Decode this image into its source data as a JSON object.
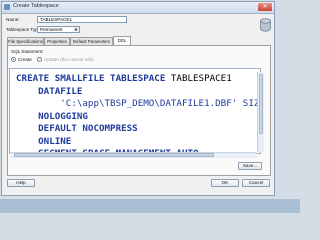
{
  "window": {
    "title": "Create Tablespace"
  },
  "form": {
    "name_label": "Name:",
    "name_value": "TABLESPACE1",
    "type_label": "Tablespace Type:",
    "type_value": "Permanent"
  },
  "tabs": [
    {
      "label": "File Specifications"
    },
    {
      "label": "Properties"
    },
    {
      "label": "Default Parameters"
    },
    {
      "label": "DDL"
    }
  ],
  "ddl": {
    "statement_label": "SQL Statement:",
    "mode_create": "Create",
    "mode_update": "Update (the current edit)",
    "lines": [
      {
        "kw": "CREATE SMALLFILE TABLESPACE",
        "rest": " TABLESPACE1"
      },
      {
        "kw": "    DATAFILE",
        "rest": ""
      },
      {
        "kw": "",
        "rest": "        'C:\\app\\TBSP_DEMO\\DATAFILE1.DBF' SIZ"
      },
      {
        "kw": "    NOLOGGING",
        "rest": ""
      },
      {
        "kw": "    DEFAULT NOCOMPRESS",
        "rest": ""
      },
      {
        "kw": "    ONLINE",
        "rest": ""
      },
      {
        "kw": "    SEGMENT SPACE MANAGEMENT AUTO",
        "rest": ""
      }
    ],
    "save_button": "Save..."
  },
  "footer": {
    "help": "Help",
    "ok": "OK",
    "cancel": "Cancel"
  },
  "colors": {
    "keyword": "#1f3b9c",
    "titlebar": "#cfdbe8",
    "close": "#c4463a"
  }
}
